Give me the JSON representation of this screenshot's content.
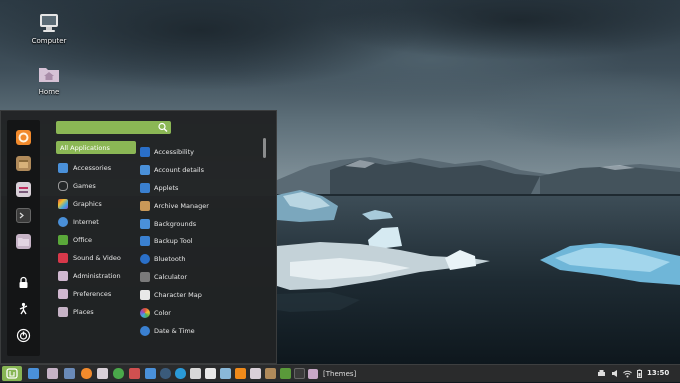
{
  "desktop": {
    "icons": [
      {
        "label": "Computer",
        "icon": "computer-icon"
      },
      {
        "label": "Home",
        "icon": "home-folder-icon"
      }
    ]
  },
  "menu": {
    "search": {
      "value": "",
      "placeholder": ""
    },
    "favorites": [
      {
        "icon": "firefox-icon",
        "color": "#f28a2c"
      },
      {
        "icon": "software-manager-icon",
        "color": "#b08a5a"
      },
      {
        "icon": "settings-icon",
        "color": "#d9d0d8"
      },
      {
        "icon": "terminal-icon",
        "color": "#3a3a3a"
      },
      {
        "icon": "files-icon",
        "color": "#c6b3c6"
      },
      {
        "icon": "lock-screen-icon",
        "color": "#ffffff"
      },
      {
        "icon": "logout-icon",
        "color": "#ffffff"
      },
      {
        "icon": "shutdown-icon",
        "color": "#ffffff"
      }
    ],
    "categories": [
      {
        "label": "All Applications",
        "icon": "all-apps-icon",
        "color": "#8bb755",
        "selected": true
      },
      {
        "label": "Accessories",
        "icon": "accessories-icon",
        "color": "#4a90d9"
      },
      {
        "label": "Games",
        "icon": "games-icon",
        "color": "#9a9a9a"
      },
      {
        "label": "Graphics",
        "icon": "graphics-icon",
        "color": "#e0503a"
      },
      {
        "label": "Internet",
        "icon": "internet-icon",
        "color": "#4a90d9"
      },
      {
        "label": "Office",
        "icon": "office-icon",
        "color": "#5aa83a"
      },
      {
        "label": "Sound & Video",
        "icon": "sound-video-icon",
        "color": "#d8384a"
      },
      {
        "label": "Administration",
        "icon": "administration-icon",
        "color": "#d0b8d0"
      },
      {
        "label": "Preferences",
        "icon": "preferences-icon",
        "color": "#d0b8d0"
      },
      {
        "label": "Places",
        "icon": "places-icon",
        "color": "#c6b3c6"
      }
    ],
    "applications": [
      {
        "label": "Accessibility",
        "icon": "accessibility-icon",
        "color": "#2a6fc8"
      },
      {
        "label": "Account details",
        "icon": "account-icon",
        "color": "#4a90d9"
      },
      {
        "label": "Applets",
        "icon": "applets-icon",
        "color": "#3a80d0"
      },
      {
        "label": "Archive Manager",
        "icon": "archive-icon",
        "color": "#c89858"
      },
      {
        "label": "Backgrounds",
        "icon": "backgrounds-icon",
        "color": "#4a90d9"
      },
      {
        "label": "Backup Tool",
        "icon": "backup-icon",
        "color": "#3a80d0"
      },
      {
        "label": "Bluetooth",
        "icon": "bluetooth-icon",
        "color": "#2a6fc8"
      },
      {
        "label": "Calculator",
        "icon": "calculator-icon",
        "color": "#7a7a7a"
      },
      {
        "label": "Character Map",
        "icon": "character-map-icon",
        "color": "#e8e8e8"
      },
      {
        "label": "Color",
        "icon": "color-icon",
        "color": "#e0503a"
      },
      {
        "label": "Date & Time",
        "icon": "date-time-icon",
        "color": "#3a80d0"
      }
    ]
  },
  "taskbar": {
    "launchers": [
      {
        "icon": "show-desktop-icon",
        "color": "#4a90d9"
      },
      {
        "icon": "files-icon",
        "color": "#c6b3c6"
      },
      {
        "icon": "screenshot-icon",
        "color": "#6a8ab8"
      },
      {
        "icon": "firefox-icon",
        "color": "#f28a2c"
      },
      {
        "icon": "mail-icon",
        "color": "#d9d0d8"
      },
      {
        "icon": "spotify-icon",
        "color": "#4aa84a"
      },
      {
        "icon": "image-viewer-icon",
        "color": "#d05050"
      },
      {
        "icon": "chat-icon",
        "color": "#4a90d9"
      },
      {
        "icon": "steam-icon",
        "color": "#3a5a7a"
      },
      {
        "icon": "skype-icon",
        "color": "#2a9ad8"
      },
      {
        "icon": "calendar-icon",
        "color": "#d8d8d8"
      },
      {
        "icon": "document-viewer-icon",
        "color": "#e8e8e8"
      },
      {
        "icon": "photos-icon",
        "color": "#8ab8d8"
      },
      {
        "icon": "media-player-icon",
        "color": "#f08a1a"
      },
      {
        "icon": "settings-icon",
        "color": "#d9d0d8"
      },
      {
        "icon": "software-manager-icon",
        "color": "#b08a5a"
      },
      {
        "icon": "chart-icon",
        "color": "#5a9a3a"
      },
      {
        "icon": "terminal-icon",
        "color": "#3a3a3a"
      }
    ],
    "window": {
      "label": "[Themes]",
      "icon": "themes-icon"
    },
    "tray": [
      {
        "icon": "printer-icon"
      },
      {
        "icon": "volume-icon"
      },
      {
        "icon": "network-icon"
      },
      {
        "icon": "battery-icon"
      }
    ],
    "clock": "13:50"
  },
  "colors": {
    "accent": "#8bb755",
    "menu_bg": "#212324",
    "panel_bg": "#2a2b2c"
  }
}
